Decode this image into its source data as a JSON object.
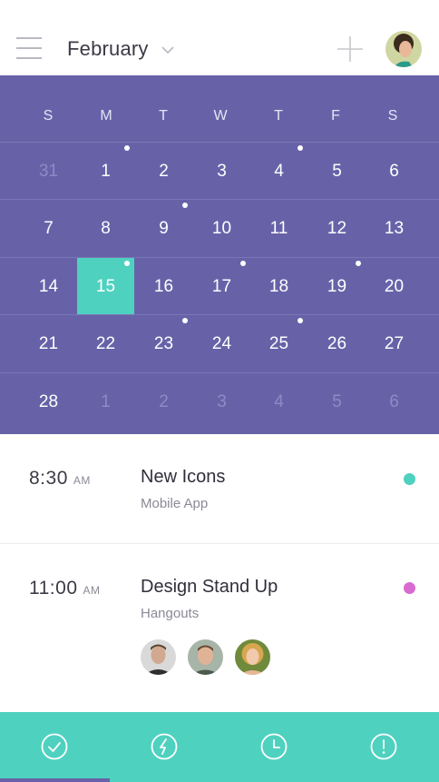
{
  "header": {
    "month": "February",
    "icons": {
      "menu": "hamburger-menu-icon",
      "dropdown": "chevron-down-icon",
      "add": "plus-icon"
    }
  },
  "calendar": {
    "weekdays": [
      "S",
      "M",
      "T",
      "W",
      "T",
      "F",
      "S"
    ],
    "weeks": [
      [
        {
          "day": "31",
          "muted": true
        },
        {
          "day": "1",
          "dot": true
        },
        {
          "day": "2"
        },
        {
          "day": "3"
        },
        {
          "day": "4",
          "dot": true
        },
        {
          "day": "5"
        },
        {
          "day": "6"
        }
      ],
      [
        {
          "day": "7"
        },
        {
          "day": "8"
        },
        {
          "day": "9",
          "dot": true
        },
        {
          "day": "10"
        },
        {
          "day": "11"
        },
        {
          "day": "12"
        },
        {
          "day": "13"
        }
      ],
      [
        {
          "day": "14"
        },
        {
          "day": "15",
          "selected": true,
          "dot": true
        },
        {
          "day": "16"
        },
        {
          "day": "17",
          "dot": true
        },
        {
          "day": "18"
        },
        {
          "day": "19",
          "dot": true
        },
        {
          "day": "20"
        }
      ],
      [
        {
          "day": "21"
        },
        {
          "day": "22"
        },
        {
          "day": "23",
          "dot": true
        },
        {
          "day": "24"
        },
        {
          "day": "25",
          "dot": true
        },
        {
          "day": "26"
        },
        {
          "day": "27"
        }
      ],
      [
        {
          "day": "28"
        },
        {
          "day": "1",
          "muted": true
        },
        {
          "day": "2",
          "muted": true
        },
        {
          "day": "3",
          "muted": true
        },
        {
          "day": "4",
          "muted": true
        },
        {
          "day": "5",
          "muted": true
        },
        {
          "day": "6",
          "muted": true
        }
      ]
    ],
    "colors": {
      "background": "#6762a8",
      "selected": "#4fd1c0"
    }
  },
  "events": [
    {
      "time": "8:30",
      "ampm": "AM",
      "title": "New Icons",
      "subtitle": "Mobile App",
      "color": "#4fd1c0"
    },
    {
      "time": "11:00",
      "ampm": "AM",
      "title": "Design Stand Up",
      "subtitle": "Hangouts",
      "color": "#d96bd0"
    }
  ],
  "bottom_nav": {
    "items": [
      {
        "icon": "checkmark-circle-icon",
        "active": true
      },
      {
        "icon": "lightning-circle-icon"
      },
      {
        "icon": "clock-icon"
      },
      {
        "icon": "alert-circle-icon"
      }
    ],
    "colors": {
      "background": "#4fd1c0",
      "indicator": "#6762a8"
    }
  }
}
